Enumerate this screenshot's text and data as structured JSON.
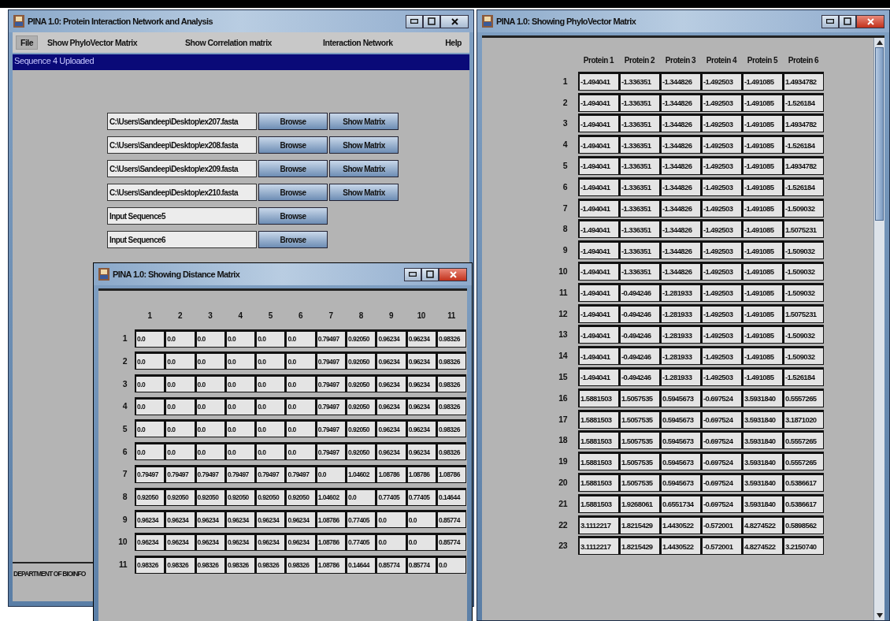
{
  "main_window": {
    "title": "PINA 1.0: Protein Interaction Network and Analysis",
    "menu": [
      {
        "label": "File",
        "selected": true
      },
      {
        "label": "Show PhyloVector Matrix",
        "selected": false
      },
      {
        "label": "Show Correlation matrix",
        "selected": false
      },
      {
        "label": "Interaction Network",
        "selected": false
      },
      {
        "label": "Help",
        "selected": false
      }
    ],
    "status": "Sequence 4 Uploaded",
    "file_rows": [
      {
        "value": "C:\\Users\\Sandeep\\Desktop\\ex207.fasta",
        "buttons": [
          "Browse",
          "Show Matrix"
        ]
      },
      {
        "value": "C:\\Users\\Sandeep\\Desktop\\ex208.fasta",
        "buttons": [
          "Browse",
          "Show Matrix"
        ]
      },
      {
        "value": "C:\\Users\\Sandeep\\Desktop\\ex209.fasta",
        "buttons": [
          "Browse",
          "Show Matrix"
        ]
      },
      {
        "value": "C:\\Users\\Sandeep\\Desktop\\ex210.fasta",
        "buttons": [
          "Browse",
          "Show Matrix"
        ]
      },
      {
        "value": "Input Sequence5",
        "buttons": [
          "Browse"
        ]
      },
      {
        "value": "Input Sequence6",
        "buttons": [
          "Browse"
        ]
      }
    ],
    "footer": "DEPARTMENT OF BIOINFO"
  },
  "distance_window": {
    "title": "PINA 1.0: Showing Distance Matrix",
    "columns": [
      "1",
      "2",
      "3",
      "4",
      "5",
      "6",
      "7",
      "8",
      "9",
      "10",
      "11"
    ],
    "rows": [
      {
        "label": "1",
        "cells": [
          "0.0",
          "0.0",
          "0.0",
          "0.0",
          "0.0",
          "0.0",
          "0.79497",
          "0.92050",
          "0.96234",
          "0.96234",
          "0.98326"
        ]
      },
      {
        "label": "2",
        "cells": [
          "0.0",
          "0.0",
          "0.0",
          "0.0",
          "0.0",
          "0.0",
          "0.79497",
          "0.92050",
          "0.96234",
          "0.96234",
          "0.98326"
        ]
      },
      {
        "label": "3",
        "cells": [
          "0.0",
          "0.0",
          "0.0",
          "0.0",
          "0.0",
          "0.0",
          "0.79497",
          "0.92050",
          "0.96234",
          "0.96234",
          "0.98326"
        ]
      },
      {
        "label": "4",
        "cells": [
          "0.0",
          "0.0",
          "0.0",
          "0.0",
          "0.0",
          "0.0",
          "0.79497",
          "0.92050",
          "0.96234",
          "0.96234",
          "0.98326"
        ]
      },
      {
        "label": "5",
        "cells": [
          "0.0",
          "0.0",
          "0.0",
          "0.0",
          "0.0",
          "0.0",
          "0.79497",
          "0.92050",
          "0.96234",
          "0.96234",
          "0.98326"
        ]
      },
      {
        "label": "6",
        "cells": [
          "0.0",
          "0.0",
          "0.0",
          "0.0",
          "0.0",
          "0.0",
          "0.79497",
          "0.92050",
          "0.96234",
          "0.96234",
          "0.98326"
        ]
      },
      {
        "label": "7",
        "cells": [
          "0.79497",
          "0.79497",
          "0.79497",
          "0.79497",
          "0.79497",
          "0.79497",
          "0.0",
          "1.04602",
          "1.08786",
          "1.08786",
          "1.08786"
        ]
      },
      {
        "label": "8",
        "cells": [
          "0.92050",
          "0.92050",
          "0.92050",
          "0.92050",
          "0.92050",
          "0.92050",
          "1.04602",
          "0.0",
          "0.77405",
          "0.77405",
          "0.14644"
        ]
      },
      {
        "label": "9",
        "cells": [
          "0.96234",
          "0.96234",
          "0.96234",
          "0.96234",
          "0.96234",
          "0.96234",
          "1.08786",
          "0.77405",
          "0.0",
          "0.0",
          "0.85774"
        ]
      },
      {
        "label": "10",
        "cells": [
          "0.96234",
          "0.96234",
          "0.96234",
          "0.96234",
          "0.96234",
          "0.96234",
          "1.08786",
          "0.77405",
          "0.0",
          "0.0",
          "0.85774"
        ]
      },
      {
        "label": "11",
        "cells": [
          "0.98326",
          "0.98326",
          "0.98326",
          "0.98326",
          "0.98326",
          "0.98326",
          "1.08786",
          "0.14644",
          "0.85774",
          "0.85774",
          "0.0"
        ]
      }
    ]
  },
  "phylo_window": {
    "title": "PINA 1.0: Showing PhyloVector Matrix",
    "columns": [
      "Protein 1",
      "Protein 2",
      "Protein 3",
      "Protein 4",
      "Protein 5",
      "Protein 6"
    ],
    "rows": [
      {
        "label": "1",
        "cells": [
          "-1.494041",
          "-1.336351",
          "-1.344826",
          "-1.492503",
          "-1.491085",
          "1.4934782"
        ]
      },
      {
        "label": "2",
        "cells": [
          "-1.494041",
          "-1.336351",
          "-1.344826",
          "-1.492503",
          "-1.491085",
          "-1.526184"
        ]
      },
      {
        "label": "3",
        "cells": [
          "-1.494041",
          "-1.336351",
          "-1.344826",
          "-1.492503",
          "-1.491085",
          "1.4934782"
        ]
      },
      {
        "label": "4",
        "cells": [
          "-1.494041",
          "-1.336351",
          "-1.344826",
          "-1.492503",
          "-1.491085",
          "-1.526184"
        ]
      },
      {
        "label": "5",
        "cells": [
          "-1.494041",
          "-1.336351",
          "-1.344826",
          "-1.492503",
          "-1.491085",
          "1.4934782"
        ]
      },
      {
        "label": "6",
        "cells": [
          "-1.494041",
          "-1.336351",
          "-1.344826",
          "-1.492503",
          "-1.491085",
          "-1.526184"
        ]
      },
      {
        "label": "7",
        "cells": [
          "-1.494041",
          "-1.336351",
          "-1.344826",
          "-1.492503",
          "-1.491085",
          "-1.509032"
        ]
      },
      {
        "label": "8",
        "cells": [
          "-1.494041",
          "-1.336351",
          "-1.344826",
          "-1.492503",
          "-1.491085",
          "1.5075231"
        ]
      },
      {
        "label": "9",
        "cells": [
          "-1.494041",
          "-1.336351",
          "-1.344826",
          "-1.492503",
          "-1.491085",
          "-1.509032"
        ]
      },
      {
        "label": "10",
        "cells": [
          "-1.494041",
          "-1.336351",
          "-1.344826",
          "-1.492503",
          "-1.491085",
          "-1.509032"
        ]
      },
      {
        "label": "11",
        "cells": [
          "-1.494041",
          "-0.494246",
          "-1.281933",
          "-1.492503",
          "-1.491085",
          "-1.509032"
        ]
      },
      {
        "label": "12",
        "cells": [
          "-1.494041",
          "-0.494246",
          "-1.281933",
          "-1.492503",
          "-1.491085",
          "1.5075231"
        ]
      },
      {
        "label": "13",
        "cells": [
          "-1.494041",
          "-0.494246",
          "-1.281933",
          "-1.492503",
          "-1.491085",
          "-1.509032"
        ]
      },
      {
        "label": "14",
        "cells": [
          "-1.494041",
          "-0.494246",
          "-1.281933",
          "-1.492503",
          "-1.491085",
          "-1.509032"
        ]
      },
      {
        "label": "15",
        "cells": [
          "-1.494041",
          "-0.494246",
          "-1.281933",
          "-1.492503",
          "-1.491085",
          "-1.526184"
        ]
      },
      {
        "label": "16",
        "cells": [
          "1.5881503",
          "1.5057535",
          "0.5945673",
          "-0.697524",
          "3.5931840",
          "0.5557265"
        ]
      },
      {
        "label": "17",
        "cells": [
          "1.5881503",
          "1.5057535",
          "0.5945673",
          "-0.697524",
          "3.5931840",
          "3.1871020"
        ]
      },
      {
        "label": "18",
        "cells": [
          "1.5881503",
          "1.5057535",
          "0.5945673",
          "-0.697524",
          "3.5931840",
          "0.5557265"
        ]
      },
      {
        "label": "19",
        "cells": [
          "1.5881503",
          "1.5057535",
          "0.5945673",
          "-0.697524",
          "3.5931840",
          "0.5557265"
        ]
      },
      {
        "label": "20",
        "cells": [
          "1.5881503",
          "1.5057535",
          "0.5945673",
          "-0.697524",
          "3.5931840",
          "0.5386617"
        ]
      },
      {
        "label": "21",
        "cells": [
          "1.5881503",
          "1.9268061",
          "0.6551734",
          "-0.697524",
          "3.5931840",
          "0.5386617"
        ]
      },
      {
        "label": "22",
        "cells": [
          "3.1112217",
          "1.8215429",
          "1.4430522",
          "-0.572001",
          "4.8274522",
          "0.5898562"
        ]
      },
      {
        "label": "23",
        "cells": [
          "3.1112217",
          "1.8215429",
          "1.4430522",
          "-0.572001",
          "4.8274522",
          "3.2150740"
        ]
      }
    ]
  }
}
